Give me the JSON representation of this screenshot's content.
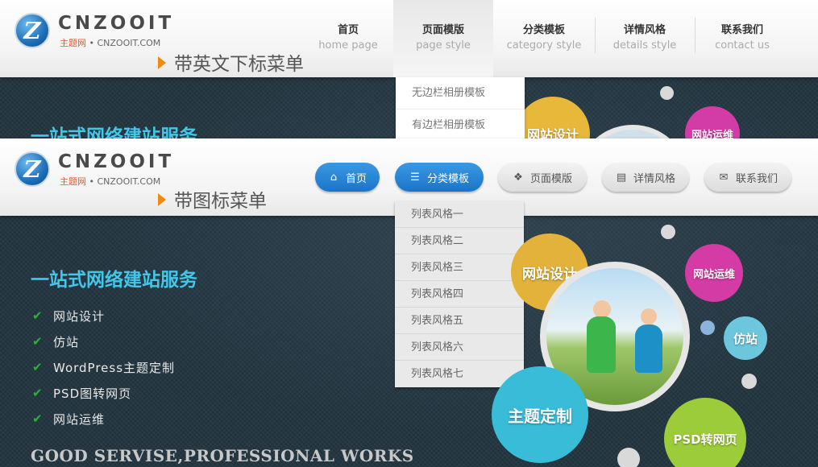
{
  "logo": {
    "brand": "CNZOOIT",
    "sub_cn": "主题网",
    "sub_sep": " • ",
    "sub_en": "CNZOOIT.COM",
    "mark": "Z"
  },
  "section1": {
    "caption": "带英文下标菜单",
    "menu": [
      {
        "zh": "首页",
        "en": "home page"
      },
      {
        "zh": "页面模版",
        "en": "page style"
      },
      {
        "zh": "分类模板",
        "en": "category style"
      },
      {
        "zh": "详情风格",
        "en": "details style"
      },
      {
        "zh": "联系我们",
        "en": "contact us"
      }
    ],
    "dropdown": [
      "无边栏相册模板",
      "有边栏相册模板"
    ]
  },
  "section2": {
    "caption": "带图标菜单",
    "menu": [
      {
        "label": "首页",
        "icon": "home-icon"
      },
      {
        "label": "分类模板",
        "icon": "list-icon"
      },
      {
        "label": "页面模版",
        "icon": "dropbox-icon"
      },
      {
        "label": "详情风格",
        "icon": "document-icon"
      },
      {
        "label": "联系我们",
        "icon": "envelope-icon"
      }
    ],
    "dropdown": [
      "列表风格一",
      "列表风格二",
      "列表风格三",
      "列表风格四",
      "列表风格五",
      "列表风格六",
      "列表风格七"
    ]
  },
  "hero": {
    "title": "一站式网络建站服务",
    "features": [
      "网站设计",
      "仿站",
      "WordPress主题定制",
      "PSD图转网页",
      "网站运维"
    ],
    "slogan": "GOOD SERVISE,PROFESSIONAL WORKS"
  },
  "bubbles": {
    "design": "网站设计",
    "ops": "网站运维",
    "clone": "仿站",
    "theme": "主题定制",
    "psd": "PSD转网页"
  },
  "colors": {
    "accent_blue": "#1b74c8",
    "title_cyan": "#45c6e8",
    "arrow_orange": "#f28a12",
    "check_green": "#2fae3d"
  }
}
